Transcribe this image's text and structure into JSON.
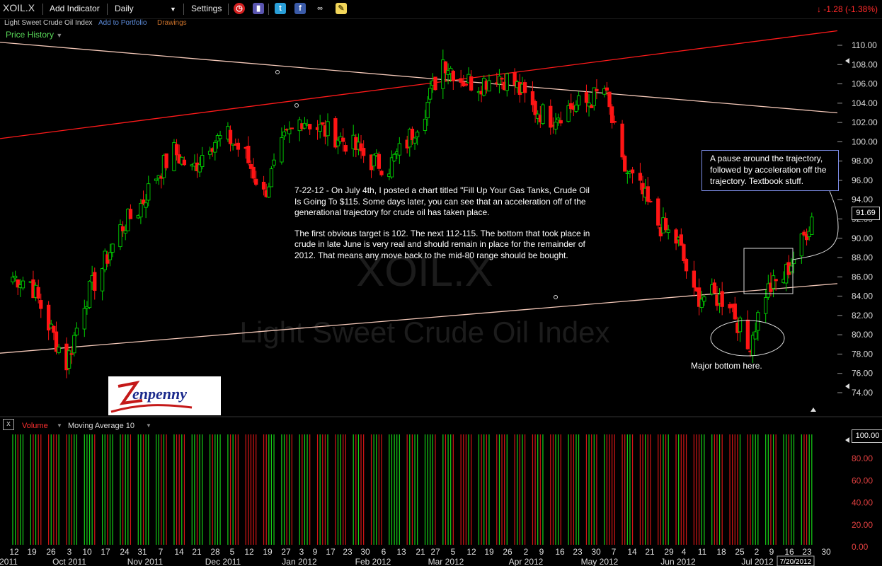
{
  "toolbar": {
    "symbol": "XOIL.X",
    "add_indicator": "Add Indicator",
    "interval": "Daily",
    "settings": "Settings",
    "icons": [
      "alarm-clock-icon",
      "tower-icon",
      "twitter-icon",
      "facebook-icon",
      "binoculars-icon",
      "note-icon"
    ]
  },
  "quote": {
    "arrow": "↓",
    "change": "-1.28 (-1.38%)",
    "last_price": "91.69",
    "color": "#ff2a2a"
  },
  "subbar": {
    "name": "Light Sweet Crude Oil Index",
    "add_to_portfolio": "Add to Portfolio",
    "drawings": "Drawings"
  },
  "price_history_label": "Price History",
  "watermark": {
    "symbol": "XOIL.X",
    "name": "Light Sweet Crude Oil Index"
  },
  "annotations": {
    "note_p1": "7-22-12 - On July 4th, I posted a chart titled \"Fill Up Your Gas Tanks, Crude Oil Is Going To $115. Some days later, you can see that an acceleration off of the generational trajectory for crude oil has taken place.",
    "note_p2": "The first obvious target is 102. The next 112-115. The bottom that took place in crude in late June is very real and should remain in place for the remainder of 2012. That means any move back to the mid-80 range should be bought.",
    "callout": "A pause around the trajectory, followed by acceleration off the trajectory. Textbook stuff.",
    "bottom_label": "Major bottom here."
  },
  "logo_text": "Zenpenny",
  "volume_bar": {
    "close": "x",
    "volume": "Volume",
    "moving_average": "Moving Average 10",
    "last_tag": "100.00"
  },
  "chart_data": {
    "type": "candlestick",
    "price_axis": {
      "ylim": [
        72.5,
        112.3
      ],
      "ticks": [
        "110.00",
        "108.00",
        "106.00",
        "104.00",
        "102.00",
        "100.00",
        "98.00",
        "96.00",
        "94.00",
        "92.00",
        "90.00",
        "88.00",
        "86.00",
        "84.00",
        "82.00",
        "80.00",
        "78.00",
        "76.00",
        "74.00"
      ]
    },
    "volume_axis": {
      "ylim": [
        0,
        100
      ],
      "ticks": [
        "100.00",
        "80.00",
        "60.00",
        "40.00",
        "20.00",
        "0.00"
      ]
    },
    "x_day_labels": [
      "12",
      "19",
      "26",
      "3",
      "10",
      "17",
      "24",
      "31",
      "7",
      "14",
      "21",
      "28",
      "5",
      "12",
      "19",
      "27",
      "3",
      "9",
      "17",
      "23",
      "30",
      "6",
      "13",
      "21",
      "27",
      "5",
      "12",
      "19",
      "26",
      "2",
      "9",
      "16",
      "23",
      "30",
      "7",
      "14",
      "21",
      "29",
      "4",
      "11",
      "18",
      "25",
      "2",
      "9",
      "16",
      "23",
      "30"
    ],
    "x_month_labels": [
      "2011",
      "Oct 2011",
      "Nov 2011",
      "Dec 2011",
      "Jan 2012",
      "Feb 2012",
      "Mar 2012",
      "Apr 2012",
      "May 2012",
      "Jun 2012",
      "Jul 2012"
    ],
    "date_tag": "7/20/2012",
    "x_start": "2011-09-12",
    "x_end": "2012-07-30",
    "key_points": [
      {
        "x": "2011-09-12",
        "y": 86.0
      },
      {
        "x": "2011-09-19",
        "y": 85.5
      },
      {
        "x": "2011-09-26",
        "y": 81.0
      },
      {
        "x": "2011-10-03",
        "y": 77.0
      },
      {
        "x": "2011-10-10",
        "y": 83.5
      },
      {
        "x": "2011-10-17",
        "y": 87.0
      },
      {
        "x": "2011-10-24",
        "y": 91.0
      },
      {
        "x": "2011-10-31",
        "y": 93.0
      },
      {
        "x": "2011-11-07",
        "y": 96.5
      },
      {
        "x": "2011-11-14",
        "y": 99.0
      },
      {
        "x": "2011-11-21",
        "y": 97.0
      },
      {
        "x": "2011-11-28",
        "y": 100.0
      },
      {
        "x": "2011-12-05",
        "y": 100.5
      },
      {
        "x": "2011-12-12",
        "y": 98.5
      },
      {
        "x": "2011-12-19",
        "y": 94.5
      },
      {
        "x": "2011-12-27",
        "y": 100.0
      },
      {
        "x": "2012-01-03",
        "y": 102.5
      },
      {
        "x": "2012-01-09",
        "y": 101.5
      },
      {
        "x": "2012-01-17",
        "y": 100.5
      },
      {
        "x": "2012-01-23",
        "y": 99.5
      },
      {
        "x": "2012-01-30",
        "y": 98.0
      },
      {
        "x": "2012-02-06",
        "y": 97.5
      },
      {
        "x": "2012-02-13",
        "y": 100.0
      },
      {
        "x": "2012-02-21",
        "y": 104.0
      },
      {
        "x": "2012-02-27",
        "y": 108.5
      },
      {
        "x": "2012-03-05",
        "y": 106.5
      },
      {
        "x": "2012-03-12",
        "y": 106.0
      },
      {
        "x": "2012-03-19",
        "y": 107.0
      },
      {
        "x": "2012-03-26",
        "y": 106.0
      },
      {
        "x": "2012-04-02",
        "y": 103.5
      },
      {
        "x": "2012-04-09",
        "y": 102.5
      },
      {
        "x": "2012-04-16",
        "y": 103.5
      },
      {
        "x": "2012-04-23",
        "y": 104.0
      },
      {
        "x": "2012-04-30",
        "y": 105.5
      },
      {
        "x": "2012-05-07",
        "y": 97.5
      },
      {
        "x": "2012-05-14",
        "y": 95.0
      },
      {
        "x": "2012-05-21",
        "y": 91.5
      },
      {
        "x": "2012-05-29",
        "y": 89.5
      },
      {
        "x": "2012-06-04",
        "y": 84.0
      },
      {
        "x": "2012-06-11",
        "y": 84.0
      },
      {
        "x": "2012-06-18",
        "y": 83.5
      },
      {
        "x": "2012-06-25",
        "y": 78.5
      },
      {
        "x": "2012-07-02",
        "y": 84.5
      },
      {
        "x": "2012-07-09",
        "y": 86.0
      },
      {
        "x": "2012-07-16",
        "y": 89.5
      },
      {
        "x": "2012-07-20",
        "y": 92.2
      }
    ],
    "trendlines": [
      {
        "name": "red",
        "from": {
          "x": "2011-09-12",
          "y": 100.5
        },
        "to": {
          "x": "2012-07-30",
          "y": 111.5
        },
        "color": "#ff1a1a"
      },
      {
        "name": "upper-salmon",
        "from": {
          "x": "2011-09-12",
          "y": 110.2
        },
        "to": {
          "x": "2012-07-30",
          "y": 103.0
        },
        "color": "#f4c8b8"
      },
      {
        "name": "lower-salmon",
        "from": {
          "x": "2011-09-12",
          "y": 78.2
        },
        "to": {
          "x": "2012-07-30",
          "y": 85.3
        },
        "color": "#f4c8b8"
      }
    ],
    "up_color": "#00d000",
    "down_color": "#ff1414",
    "grid": false
  }
}
